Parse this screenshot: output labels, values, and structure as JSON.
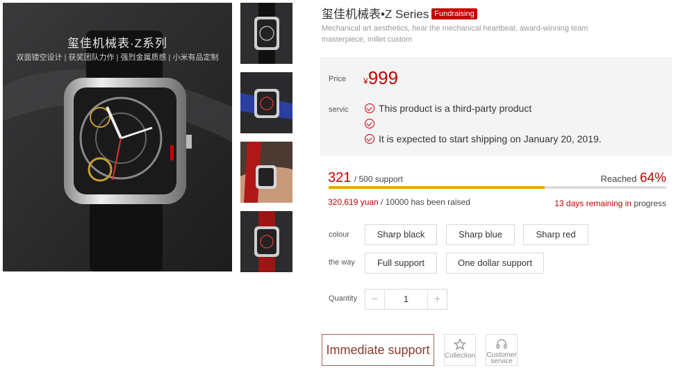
{
  "gallery": {
    "main_headline": "玺佳机械表·Z系列",
    "main_tagline": "双面镂空设计 | 获奖团队力作 | 强烈金属质感 | 小米有品定制",
    "thumbs": [
      "silver-black strap",
      "blue strap",
      "worn on wrist",
      "red strap"
    ]
  },
  "product": {
    "title": "玺佳机械表•Z Series",
    "badge": "Fundraising",
    "subtitle": "Mechanical art aesthetics, hear the mechanical heartbeat, award-winning team masterpiece, millet custom"
  },
  "price": {
    "label": "Price",
    "currency": "¥",
    "value": "999"
  },
  "service": {
    "label": "servic",
    "items": [
      "This product is a third-party product",
      "",
      "It is expected to start shipping on January 20, 2019."
    ]
  },
  "funding": {
    "support_count": "321",
    "support_total": "/ 500 support",
    "reached_label": "Reached",
    "reached_pct": "64%",
    "progress": 0.64,
    "raised_amount": "320,619 yuan",
    "raised_rest": "/ 10000 has been raised",
    "days_text": "13 days remaining in",
    "days_suffix": "progress"
  },
  "options": {
    "colour_label": "colour",
    "colours": [
      "Sharp black",
      "Sharp blue",
      "Sharp red"
    ],
    "way_label": "the way",
    "ways": [
      "Full support",
      "One dollar support"
    ]
  },
  "quantity": {
    "label": "Quantity",
    "minus": "−",
    "value": "1",
    "plus": "+"
  },
  "actions": {
    "immediate": "Immediate support",
    "collection": "Collection",
    "customer_service": "Customer service"
  },
  "colors": {
    "accent": "#c40000",
    "progress": "#f0a30a",
    "immediate_border": "#a0645a"
  }
}
